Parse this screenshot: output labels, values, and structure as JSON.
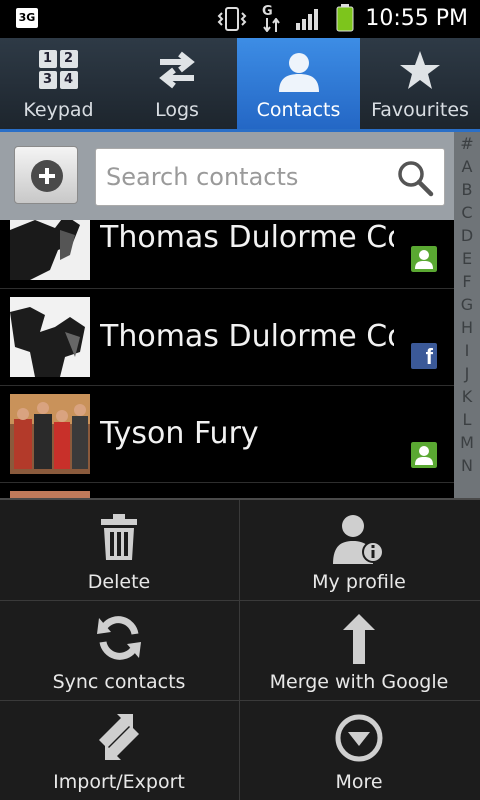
{
  "status_bar": {
    "network_type": "3G",
    "data_indicator": "G",
    "time": "10:55 PM",
    "icons": [
      "3g-icon",
      "vibrate-icon",
      "data-transfer-icon",
      "signal-icon",
      "battery-icon"
    ]
  },
  "tabs": [
    {
      "label": "Keypad",
      "icon": "keypad-icon",
      "active": false
    },
    {
      "label": "Logs",
      "icon": "logs-icon",
      "active": false
    },
    {
      "label": "Contacts",
      "icon": "contacts-icon",
      "active": true
    },
    {
      "label": "Favourites",
      "icon": "star-icon",
      "active": false
    }
  ],
  "keypad_digits": [
    "1",
    "2",
    "3",
    "4"
  ],
  "search": {
    "placeholder": "Search contacts"
  },
  "alphabet_index": [
    "#",
    "A",
    "B",
    "C",
    "D",
    "E",
    "F",
    "G",
    "H",
    "I",
    "J",
    "K",
    "L",
    "M",
    "N"
  ],
  "contacts": [
    {
      "name": "Thomas Dulorme Cor",
      "source": "contact-account-icon"
    },
    {
      "name": "Thomas Dulorme Cor",
      "source": "facebook-icon",
      "source_letter": "f"
    },
    {
      "name": "Tyson Fury",
      "source": "contact-account-icon"
    }
  ],
  "menu": {
    "items": [
      {
        "label": "Delete",
        "icon": "trash-icon"
      },
      {
        "label": "My profile",
        "icon": "profile-info-icon"
      },
      {
        "label": "Sync contacts",
        "icon": "sync-icon"
      },
      {
        "label": "Merge with Google",
        "icon": "merge-icon"
      },
      {
        "label": "Import/Export",
        "icon": "import-export-icon"
      },
      {
        "label": "More",
        "icon": "more-icon"
      }
    ]
  },
  "colors": {
    "active_tab": "#2a6fc7",
    "contact_badge": "#5aa832",
    "facebook": "#3b5998",
    "battery": "#7dc51c"
  }
}
